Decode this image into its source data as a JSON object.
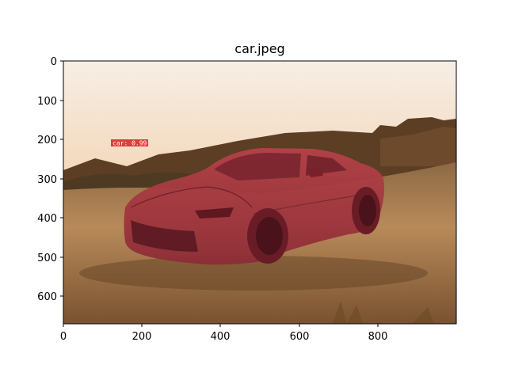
{
  "figure": {
    "title": "car.jpeg",
    "x_ticks": [
      "0",
      "200",
      "400",
      "600",
      "800"
    ],
    "y_ticks": [
      "0",
      "100",
      "200",
      "300",
      "400",
      "500",
      "600"
    ],
    "image_extent": {
      "width": 1000,
      "height": 670
    }
  },
  "detection": {
    "label": "car: 0.99",
    "class": "car",
    "score": 0.99,
    "mask_color": "#c0282e",
    "label_bg_color": "#e33b3b"
  },
  "colors": {
    "sky_top": "#f7e6d4",
    "sky_bottom": "#f0b98a",
    "ground": "#b07a45",
    "hills": "#5a3d22"
  }
}
